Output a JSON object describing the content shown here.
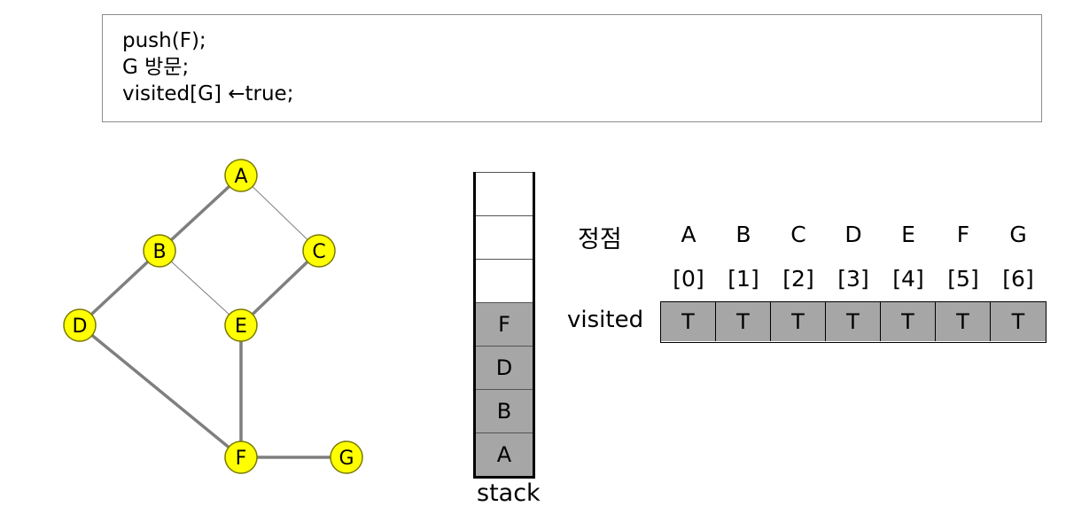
{
  "code": {
    "lines": [
      "push(F);",
      "G 방문;",
      "visited[G] ←true;"
    ]
  },
  "colors": {
    "node_fill": "#ffff00",
    "node_stroke": "#7a7a00",
    "edge": "#7f7f7f",
    "cell_fill": "#a6a6a6"
  },
  "graph": {
    "nodes": [
      {
        "id": "A",
        "label": "A"
      },
      {
        "id": "B",
        "label": "B"
      },
      {
        "id": "C",
        "label": "C"
      },
      {
        "id": "D",
        "label": "D"
      },
      {
        "id": "E",
        "label": "E"
      },
      {
        "id": "F",
        "label": "F"
      },
      {
        "id": "G",
        "label": "G"
      }
    ],
    "edges": [
      {
        "from": "A",
        "to": "B",
        "weight": "bold"
      },
      {
        "from": "A",
        "to": "C",
        "weight": "thin"
      },
      {
        "from": "B",
        "to": "D",
        "weight": "bold"
      },
      {
        "from": "B",
        "to": "E",
        "weight": "thin"
      },
      {
        "from": "C",
        "to": "E",
        "weight": "bold"
      },
      {
        "from": "D",
        "to": "F",
        "weight": "bold"
      },
      {
        "from": "E",
        "to": "F",
        "weight": "bold"
      },
      {
        "from": "F",
        "to": "G",
        "weight": "bold"
      }
    ]
  },
  "stack": {
    "label": "stack",
    "items": [
      "A",
      "B",
      "D",
      "F"
    ],
    "capacity": 7
  },
  "visited_table": {
    "vertex_header": "정점",
    "row_label": "visited",
    "vertices": [
      "A",
      "B",
      "C",
      "D",
      "E",
      "F",
      "G"
    ],
    "indices": [
      "[0]",
      "[1]",
      "[2]",
      "[3]",
      "[4]",
      "[5]",
      "[6]"
    ],
    "values": [
      "T",
      "T",
      "T",
      "T",
      "T",
      "T",
      "T"
    ]
  }
}
